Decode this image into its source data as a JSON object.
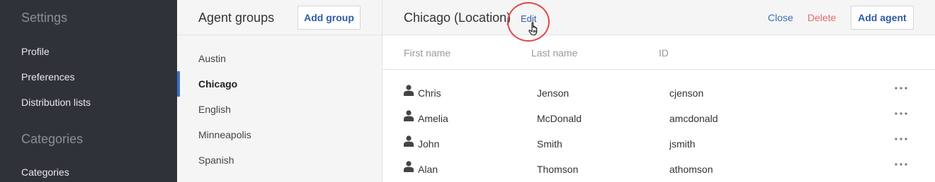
{
  "sidebar": {
    "sections": [
      {
        "heading": "Settings",
        "items": [
          "Profile",
          "Preferences",
          "Distribution lists"
        ]
      },
      {
        "heading": "Categories",
        "items": [
          "Categories"
        ]
      }
    ]
  },
  "groups_panel": {
    "title": "Agent groups",
    "add_button": "Add group",
    "groups": [
      "Austin",
      "Chicago",
      "English",
      "Minneapolis",
      "Spanish"
    ],
    "active_group": "Chicago"
  },
  "main": {
    "title": "Chicago (Location)",
    "edit_label": "Edit",
    "close_label": "Close",
    "delete_label": "Delete",
    "add_agent_label": "Add agent",
    "columns": [
      "First name",
      "Last name",
      "ID"
    ],
    "rows": [
      {
        "first": "Chris",
        "last": "Jenson",
        "id": "cjenson"
      },
      {
        "first": "Amelia",
        "last": "McDonald",
        "id": "amcdonald"
      },
      {
        "first": "John",
        "last": "Smith",
        "id": "jsmith"
      },
      {
        "first": "Alan",
        "last": "Thomson",
        "id": "athomson"
      }
    ]
  },
  "colors": {
    "sidebar_bg": "#2f3238",
    "accent": "#3e6ec1",
    "link": "#2e5aa6",
    "delete": "#e06b6b",
    "highlight": "#e04848"
  },
  "icons": {
    "user": "person-icon",
    "row_menu": "more-horizontal-icon",
    "pointer": "hand-pointer-icon"
  }
}
